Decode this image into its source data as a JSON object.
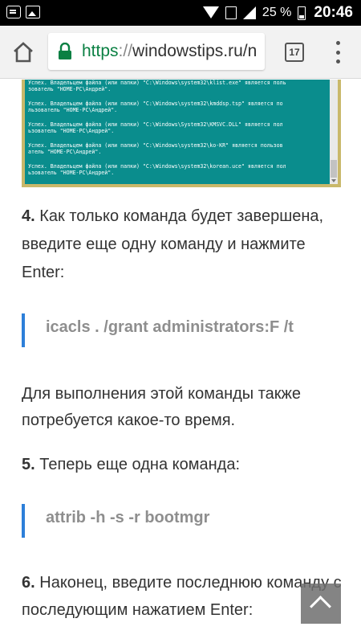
{
  "status_bar": {
    "battery_percent": "25 %",
    "time": "20:46",
    "icons": [
      "notification-icon",
      "image-icon",
      "wifi-icon",
      "sim-icon",
      "signal-icon",
      "battery-icon"
    ]
  },
  "browser": {
    "url_scheme": "https",
    "url_separator": "://",
    "url_host": "windowstips.ru/n",
    "tabs_count": "17",
    "accent_color": "#0b8043"
  },
  "console": {
    "lines": [
      "Успех. Владельцем файла (или папки) \"C:\\Windows\\system32\\klist.exe\" является поль",
      "зователь \"HOME-PC\\Андрей\".",
      "Успех. Владельцем файла (или папки) \"C:\\Windows\\system32\\kmddsp.tsp\" является по",
      "льзователь \"HOME-PC\\Андрей\".",
      "Успех. Владельцем файла (или папки) \"C:\\Windows\\System32\\KMSVC.DLL\" является пол",
      "ьзователь \"HOME-PC\\Андрей\".",
      "Успех. Владельцем файла (или папки) \"C:\\Windows\\system32\\ko-KR\" является пользов",
      "атель \"HOME-PC\\Андрей\".",
      "Успех. Владельцем файла (или папки) \"C:\\Windows\\system32\\korean.uce\" является пол",
      "ьзователь \"HOME-PC\\Андрей\"."
    ],
    "background_color": "#0a8d8d"
  },
  "article": {
    "step4_num": "4.",
    "step4_line1": "Как только команда будет завершена,",
    "step4_line2": "введите еще одну команду и нажмите",
    "step4_line3": "Enter:",
    "command1": "icacls . /grant administrators:F /t",
    "para_line1": "Для выполнения этой команды также",
    "para_line2": "потребуется какое-то время.",
    "step5_num": "5.",
    "step5_text": "Теперь еще одна команда:",
    "command2": "attrib -h -s -r bootmgr",
    "step6_num": "6.",
    "step6_line1": "Наконец, введите последнюю команду с",
    "step6_line2": "последующим нажатием Enter:",
    "quote_border_color": "#2d7fd9"
  }
}
